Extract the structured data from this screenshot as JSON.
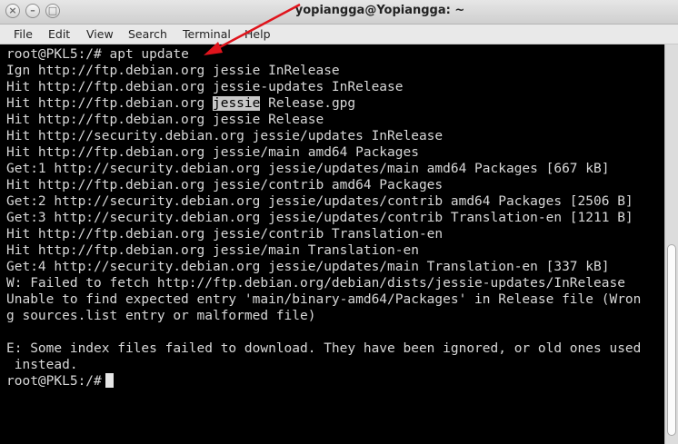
{
  "window": {
    "title": "yopiangga@Yopiangga: ~",
    "buttons": [
      "×",
      "–",
      "□"
    ]
  },
  "menubar": [
    "File",
    "Edit",
    "View",
    "Search",
    "Terminal",
    "Help"
  ],
  "terminal": {
    "prompt": "root@PKL5:/# ",
    "command": "apt update",
    "lines": [
      "Ign http://ftp.debian.org jessie InRelease",
      "Hit http://ftp.debian.org jessie-updates InRelease",
      "Hit http://ftp.debian.org jessie Release.gpg",
      "Hit http://ftp.debian.org jessie Release",
      "Hit http://security.debian.org jessie/updates InRelease",
      "Hit http://ftp.debian.org jessie/main amd64 Packages",
      "Get:1 http://security.debian.org jessie/updates/main amd64 Packages [667 kB]",
      "Hit http://ftp.debian.org jessie/contrib amd64 Packages",
      "Get:2 http://security.debian.org jessie/updates/contrib amd64 Packages [2506 B]",
      "Get:3 http://security.debian.org jessie/updates/contrib Translation-en [1211 B]",
      "Hit http://ftp.debian.org jessie/contrib Translation-en",
      "Hit http://ftp.debian.org jessie/main Translation-en",
      "Get:4 http://security.debian.org jessie/updates/main Translation-en [337 kB]",
      "W: Failed to fetch http://ftp.debian.org/debian/dists/jessie-updates/InRelease",
      "Unable to find expected entry 'main/binary-amd64/Packages' in Release file (Wron",
      "g sources.list entry or malformed file)",
      "",
      "E: Some index files failed to download. They have been ignored, or old ones used",
      " instead."
    ],
    "highlight": {
      "line_index": 2,
      "before": "Hit http://ftp.debian.org ",
      "selected": "jessie",
      "after": " Release.gpg"
    },
    "final_prompt": "root@PKL5:/# "
  },
  "scrollbar": {
    "thumb_start": 0.5,
    "thumb_end": 0.98
  },
  "annotation": {
    "color": "#e0141c"
  }
}
